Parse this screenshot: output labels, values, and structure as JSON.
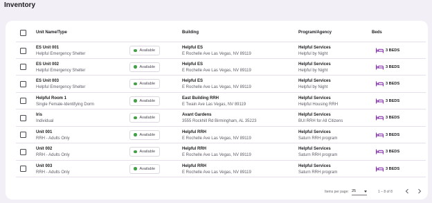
{
  "page": {
    "title": "Inventory"
  },
  "colors": {
    "available_dot": "#43a047",
    "bed_icon": "#7b1fa2"
  },
  "table": {
    "headers": {
      "unit": "Unit Name/Type",
      "building": "Building",
      "program": "Program/Agency",
      "beds": "Beds"
    },
    "rows": [
      {
        "unit_name": "ES Unit 001",
        "unit_type": "Helpful Emergency Shelter",
        "status": "Available",
        "building_name": "Helpful ES",
        "building_address": "E Rochelle Ave Las Vegas, NV 89119",
        "program_name": "Helpful Services",
        "agency_name": "Helpful by Night",
        "beds": "3 BEDS"
      },
      {
        "unit_name": "ES Unit 002",
        "unit_type": "Helpful Emergency Shelter",
        "status": "Available",
        "building_name": "Helpful ES",
        "building_address": "E Rochelle Ave Las Vegas, NV 89119",
        "program_name": "Helpful Services",
        "agency_name": "Helpful by Night",
        "beds": "3 BEDS"
      },
      {
        "unit_name": "ES Unit 003",
        "unit_type": "Helpful Emergency Shelter",
        "status": "Available",
        "building_name": "Helpful ES",
        "building_address": "E Rochelle Ave Las Vegas, NV 89119",
        "program_name": "Helpful Services",
        "agency_name": "Helpful by Night",
        "beds": "3 BEDS"
      },
      {
        "unit_name": "Helpful Room 1",
        "unit_type": "Single Female-Identifying Dorm",
        "status": "Available",
        "building_name": "East Building RRH",
        "building_address": "E Twain Ave Las Vegas, NV 89119",
        "program_name": "Helpful Services",
        "agency_name": "Helpful Housing RRH",
        "beds": "3 BEDS"
      },
      {
        "unit_name": "Iris",
        "unit_type": "Individual",
        "status": "Available",
        "building_name": "Avant Gardens",
        "building_address": "3555 Rockhill Rd Birmingham, AL 35223",
        "program_name": "Helpful Services",
        "agency_name": "BUI RRH for All Citizens",
        "beds": "3 BEDS"
      },
      {
        "unit_name": "Unit 001",
        "unit_type": "RRH - Adults Only",
        "status": "Available",
        "building_name": "Helpful RRH",
        "building_address": "E Rochelle Ave Las Vegas, NV 89119",
        "program_name": "Helpful Services",
        "agency_name": "Saturn RRH program",
        "beds": "3 BEDS"
      },
      {
        "unit_name": "Unit 002",
        "unit_type": "RRH - Adults Only",
        "status": "Available",
        "building_name": "Helpful RRH",
        "building_address": "E Rochelle Ave Las Vegas, NV 89119",
        "program_name": "Helpful Services",
        "agency_name": "Saturn RRH program",
        "beds": "3 BEDS"
      },
      {
        "unit_name": "Unit 003",
        "unit_type": "RRH - Adults Only",
        "status": "Available",
        "building_name": "Helpful RRH",
        "building_address": "E Rochelle Ave Las Vegas, NV 89119",
        "program_name": "Helpful Services",
        "agency_name": "Saturn RRH program",
        "beds": "3 BEDS"
      }
    ]
  },
  "pagination": {
    "items_per_page_label": "Items per page:",
    "items_per_page_value": "25",
    "range_label": "1 – 8 of 8",
    "prev_icon": "chevron-left-icon",
    "next_icon": "chevron-right-icon"
  }
}
